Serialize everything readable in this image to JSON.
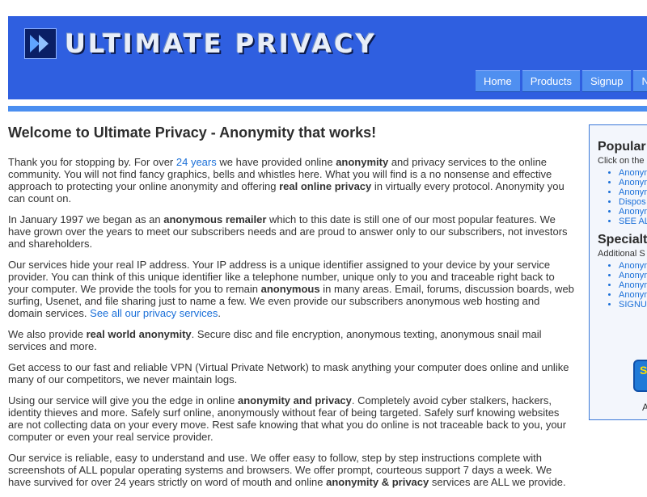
{
  "header": {
    "logo_text": "ULTIMATE PRIVACY",
    "nav": [
      "Home",
      "Products",
      "Signup",
      "N"
    ]
  },
  "main": {
    "title": "Welcome to Ultimate Privacy - Anonymity that works!",
    "p1": {
      "a": "Thank you for stopping by. For over ",
      "link": "24 years",
      "b": " we have provided online ",
      "strong1": "anonymity",
      "c": " and privacy services to the online community. You will not find fancy graphics, bells and whistles here. What you will find is a no nonsense and effective approach to protecting your online anonymity and offering ",
      "strong2": "real online privacy",
      "d": " in virtually every protocol. Anonymity you can count on."
    },
    "p2": {
      "a": "In January 1997 we began as an ",
      "strong": "anonymous remailer",
      "b": " which to this date is still one of our most popular features. We have grown over the years to meet our subscribers needs and are proud to answer only to our subscribers, not investors and shareholders."
    },
    "p3": {
      "a": "Our services hide your real IP address. Your IP address is a unique identifier assigned to your device by your service provider. You can think of this unique identifier like a telephone number, unique only to you and traceable right back to your computer. We provide the tools for you to remain ",
      "strong": "anonymous",
      "b": " in many areas. Email, forums, discussion boards, web surfing, Usenet, and file sharing just to name a few. We even provide our subscribers anonymous web hosting and domain services. ",
      "link": "See all our privacy services",
      "c": "."
    },
    "p4": {
      "a": "We also provide ",
      "strong": "real world anonymity",
      "b": ". Secure disc and file encryption, anonymous texting, anonymous snail mail services and more."
    },
    "p5": "Get access to our fast and reliable VPN (Virtual Private Network) to mask anything your computer does online and unlike many of our competitors, we never maintain logs.",
    "p6": {
      "a": "Using our service will give you the edge in online ",
      "strong": "anonymity and privacy",
      "b": ". Completely avoid cyber stalkers, hackers, identity thieves and more. Safely surf online, anonymously without fear of being targeted. Safely surf knowing websites are not collecting data on your every move. Rest safe knowing that what you do online is not traceable back to you, your computer or even your real service provider."
    },
    "p7": {
      "a": "Our service is reliable, easy to understand and use. We offer easy to follow, step by step instructions complete with screenshots of ALL popular operating systems and browsers. We offer prompt, courteous support 7 days a week. We have survived for over 24 years strictly on word of mouth and online ",
      "strong": "anonymity & privacy",
      "b": " services are ALL we provide."
    }
  },
  "sidebar": {
    "popular_heading": "Popular",
    "popular_sub": "Click on the",
    "popular_links": [
      "Anonym",
      "Anonym",
      "Anonym",
      "Dispos",
      "Anonym",
      "SEE AL"
    ],
    "specialty_heading": "Specialt",
    "specialty_sub": "Additional S",
    "specialty_links": [
      "Anonym",
      "Anonym",
      "Anonym",
      "Anonym",
      "SIGNU"
    ],
    "badge_text": "S",
    "footer_text": "A"
  }
}
